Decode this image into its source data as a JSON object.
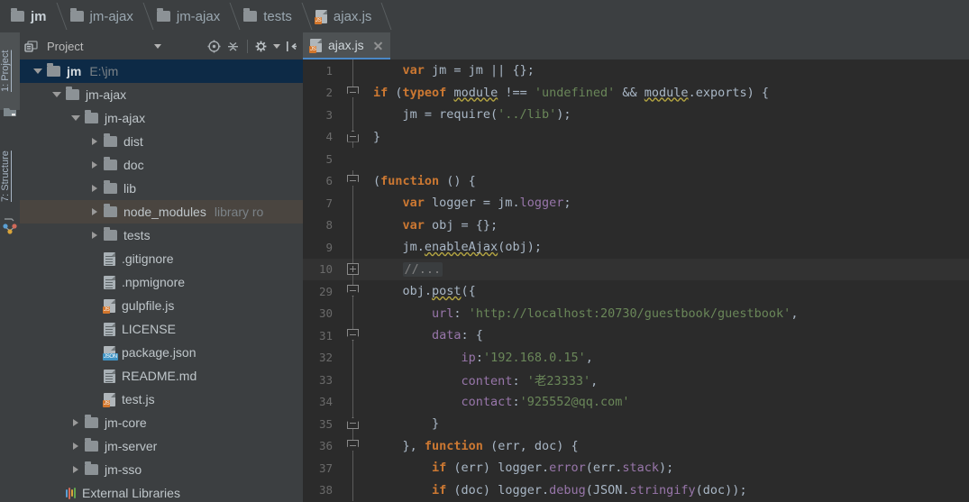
{
  "breadcrumb": [
    {
      "label": "jm",
      "icon": "folder-icon",
      "bold": true
    },
    {
      "label": "jm-ajax",
      "icon": "folder-icon",
      "bold": false
    },
    {
      "label": "jm-ajax",
      "icon": "folder-icon",
      "bold": false
    },
    {
      "label": "tests",
      "icon": "folder-icon",
      "bold": false
    },
    {
      "label": "ajax.js",
      "icon": "js-file-icon",
      "bold": false
    }
  ],
  "toolwindows": [
    {
      "label": "1: Project",
      "icon": "project-icon",
      "selected": true
    },
    {
      "label": "7: Structure",
      "icon": "structure-icon",
      "selected": false
    }
  ],
  "project_panel": {
    "title": "Project",
    "toolbar_icons": [
      "select-opened-file-icon",
      "collapse-all-icon",
      "settings-gear-icon",
      "hide-panel-icon"
    ],
    "tree": [
      {
        "label": "jm",
        "suffix": "E:\\jm",
        "depth": 0,
        "icon": "folder-icon",
        "twisty": "open",
        "state": "selected",
        "bold": true
      },
      {
        "label": "jm-ajax",
        "suffix": "",
        "depth": 1,
        "icon": "folder-icon",
        "twisty": "open",
        "state": "",
        "bold": false
      },
      {
        "label": "jm-ajax",
        "suffix": "",
        "depth": 2,
        "icon": "folder-icon",
        "twisty": "open",
        "state": "",
        "bold": false
      },
      {
        "label": "dist",
        "suffix": "",
        "depth": 3,
        "icon": "folder-icon",
        "twisty": "closed",
        "state": "",
        "bold": false
      },
      {
        "label": "doc",
        "suffix": "",
        "depth": 3,
        "icon": "folder-icon",
        "twisty": "closed",
        "state": "",
        "bold": false
      },
      {
        "label": "lib",
        "suffix": "",
        "depth": 3,
        "icon": "folder-icon",
        "twisty": "closed",
        "state": "",
        "bold": false
      },
      {
        "label": "node_modules",
        "suffix": "library ro",
        "depth": 3,
        "icon": "folder-icon",
        "twisty": "closed",
        "state": "hover",
        "bold": false
      },
      {
        "label": "tests",
        "suffix": "",
        "depth": 3,
        "icon": "folder-icon",
        "twisty": "closed",
        "state": "",
        "bold": false
      },
      {
        "label": ".gitignore",
        "suffix": "",
        "depth": 3,
        "icon": "text-file-icon",
        "twisty": "none",
        "state": "",
        "bold": false
      },
      {
        "label": ".npmignore",
        "suffix": "",
        "depth": 3,
        "icon": "text-file-icon",
        "twisty": "none",
        "state": "",
        "bold": false
      },
      {
        "label": "gulpfile.js",
        "suffix": "",
        "depth": 3,
        "icon": "js-file-icon",
        "twisty": "none",
        "state": "",
        "bold": false
      },
      {
        "label": "LICENSE",
        "suffix": "",
        "depth": 3,
        "icon": "text-file-icon",
        "twisty": "none",
        "state": "",
        "bold": false
      },
      {
        "label": "package.json",
        "suffix": "",
        "depth": 3,
        "icon": "json-file-icon",
        "twisty": "none",
        "state": "",
        "bold": false
      },
      {
        "label": "README.md",
        "suffix": "",
        "depth": 3,
        "icon": "text-file-icon",
        "twisty": "none",
        "state": "",
        "bold": false
      },
      {
        "label": "test.js",
        "suffix": "",
        "depth": 3,
        "icon": "js-file-icon",
        "twisty": "none",
        "state": "",
        "bold": false
      },
      {
        "label": "jm-core",
        "suffix": "",
        "depth": 2,
        "icon": "folder-icon",
        "twisty": "closed",
        "state": "",
        "bold": false
      },
      {
        "label": "jm-server",
        "suffix": "",
        "depth": 2,
        "icon": "folder-icon",
        "twisty": "closed",
        "state": "",
        "bold": false
      },
      {
        "label": "jm-sso",
        "suffix": "",
        "depth": 2,
        "icon": "folder-icon",
        "twisty": "closed",
        "state": "",
        "bold": false
      },
      {
        "label": "External Libraries",
        "suffix": "",
        "depth": 1,
        "icon": "external-libraries-icon",
        "twisty": "none",
        "state": "",
        "bold": false
      }
    ]
  },
  "editor": {
    "tabs": [
      {
        "label": "ajax.js",
        "icon": "js-file-icon",
        "active": true,
        "closable": true
      }
    ],
    "lines": [
      {
        "n": "1",
        "fold": "none",
        "bar": true,
        "highlight": false,
        "tokens": [
          {
            "t": "    ",
            "c": "pl"
          },
          {
            "t": "var",
            "c": "kw"
          },
          {
            "t": " jm = jm || {};",
            "c": "pl"
          }
        ]
      },
      {
        "n": "2",
        "fold": "top",
        "bar": false,
        "highlight": false,
        "tokens": [
          {
            "t": "",
            "c": "pl"
          },
          {
            "t": "if",
            "c": "kw"
          },
          {
            "t": " (",
            "c": "pl"
          },
          {
            "t": "typeof",
            "c": "kw"
          },
          {
            "t": " ",
            "c": "pl"
          },
          {
            "t": "module",
            "c": "warn"
          },
          {
            "t": " !== ",
            "c": "pl"
          },
          {
            "t": "'undefined'",
            "c": "str"
          },
          {
            "t": " && ",
            "c": "pl"
          },
          {
            "t": "module",
            "c": "warn"
          },
          {
            "t": ".exports) {",
            "c": "pl"
          }
        ]
      },
      {
        "n": "3",
        "fold": "none",
        "bar": true,
        "highlight": false,
        "tokens": [
          {
            "t": "    jm = require(",
            "c": "pl"
          },
          {
            "t": "'../lib'",
            "c": "str"
          },
          {
            "t": ");",
            "c": "pl"
          }
        ]
      },
      {
        "n": "4",
        "fold": "bottom",
        "bar": false,
        "highlight": false,
        "tokens": [
          {
            "t": "}",
            "c": "pl"
          }
        ]
      },
      {
        "n": "5",
        "fold": "none",
        "bar": false,
        "highlight": false,
        "tokens": []
      },
      {
        "n": "6",
        "fold": "top",
        "bar": false,
        "highlight": false,
        "tokens": [
          {
            "t": "(",
            "c": "pl"
          },
          {
            "t": "function",
            "c": "kw"
          },
          {
            "t": " () {",
            "c": "pl"
          }
        ]
      },
      {
        "n": "7",
        "fold": "none",
        "bar": true,
        "highlight": false,
        "tokens": [
          {
            "t": "    ",
            "c": "pl"
          },
          {
            "t": "var",
            "c": "kw"
          },
          {
            "t": " logger = jm.",
            "c": "pl"
          },
          {
            "t": "logger",
            "c": "prop"
          },
          {
            "t": ";",
            "c": "pl"
          }
        ]
      },
      {
        "n": "8",
        "fold": "none",
        "bar": true,
        "highlight": false,
        "tokens": [
          {
            "t": "    ",
            "c": "pl"
          },
          {
            "t": "var",
            "c": "kw"
          },
          {
            "t": " obj = {};",
            "c": "pl"
          }
        ]
      },
      {
        "n": "9",
        "fold": "none",
        "bar": true,
        "highlight": false,
        "tokens": [
          {
            "t": "    jm.",
            "c": "pl"
          },
          {
            "t": "enableAjax",
            "c": "warn"
          },
          {
            "t": "(obj);",
            "c": "pl"
          }
        ]
      },
      {
        "n": "10",
        "fold": "plus",
        "bar": true,
        "highlight": true,
        "tokens": [
          {
            "t": "    ",
            "c": "pl"
          },
          {
            "t": "//...",
            "c": "cmt fold-b"
          }
        ]
      },
      {
        "n": "29",
        "fold": "top",
        "bar": true,
        "highlight": false,
        "tokens": [
          {
            "t": "    obj.",
            "c": "pl"
          },
          {
            "t": "post",
            "c": "warn"
          },
          {
            "t": "({",
            "c": "pl"
          }
        ]
      },
      {
        "n": "30",
        "fold": "none",
        "bar": true,
        "highlight": false,
        "tokens": [
          {
            "t": "        ",
            "c": "pl"
          },
          {
            "t": "url",
            "c": "prop"
          },
          {
            "t": ": ",
            "c": "pl"
          },
          {
            "t": "'http://localhost:20730/guestbook/guestbook'",
            "c": "str"
          },
          {
            "t": ",",
            "c": "pl"
          }
        ]
      },
      {
        "n": "31",
        "fold": "top",
        "bar": true,
        "highlight": false,
        "tokens": [
          {
            "t": "        ",
            "c": "pl"
          },
          {
            "t": "data",
            "c": "prop"
          },
          {
            "t": ": {",
            "c": "pl"
          }
        ]
      },
      {
        "n": "32",
        "fold": "none",
        "bar": true,
        "highlight": false,
        "tokens": [
          {
            "t": "            ",
            "c": "pl"
          },
          {
            "t": "ip",
            "c": "prop"
          },
          {
            "t": ":",
            "c": "pl"
          },
          {
            "t": "'192.168.0.15'",
            "c": "str"
          },
          {
            "t": ",",
            "c": "pl"
          }
        ]
      },
      {
        "n": "33",
        "fold": "none",
        "bar": true,
        "highlight": false,
        "tokens": [
          {
            "t": "            ",
            "c": "pl"
          },
          {
            "t": "content",
            "c": "prop"
          },
          {
            "t": ": ",
            "c": "pl"
          },
          {
            "t": "'老23333'",
            "c": "str"
          },
          {
            "t": ",",
            "c": "pl"
          }
        ]
      },
      {
        "n": "34",
        "fold": "none",
        "bar": true,
        "highlight": false,
        "tokens": [
          {
            "t": "            ",
            "c": "pl"
          },
          {
            "t": "contact",
            "c": "prop"
          },
          {
            "t": ":",
            "c": "pl"
          },
          {
            "t": "'925552@qq.com'",
            "c": "str"
          }
        ]
      },
      {
        "n": "35",
        "fold": "bottom",
        "bar": true,
        "highlight": false,
        "tokens": [
          {
            "t": "        }",
            "c": "pl"
          }
        ]
      },
      {
        "n": "36",
        "fold": "top",
        "bar": true,
        "highlight": false,
        "tokens": [
          {
            "t": "    }, ",
            "c": "pl"
          },
          {
            "t": "function",
            "c": "kw"
          },
          {
            "t": " (err, doc) {",
            "c": "pl"
          }
        ]
      },
      {
        "n": "37",
        "fold": "none",
        "bar": true,
        "highlight": false,
        "tokens": [
          {
            "t": "        ",
            "c": "pl"
          },
          {
            "t": "if",
            "c": "kw"
          },
          {
            "t": " (err) logger.",
            "c": "pl"
          },
          {
            "t": "error",
            "c": "prop"
          },
          {
            "t": "(err.",
            "c": "pl"
          },
          {
            "t": "stack",
            "c": "prop"
          },
          {
            "t": ");",
            "c": "pl"
          }
        ]
      },
      {
        "n": "38",
        "fold": "none",
        "bar": true,
        "highlight": false,
        "tokens": [
          {
            "t": "        ",
            "c": "pl"
          },
          {
            "t": "if",
            "c": "kw"
          },
          {
            "t": " (doc) logger.",
            "c": "pl"
          },
          {
            "t": "debug",
            "c": "prop"
          },
          {
            "t": "(JSON.",
            "c": "pl"
          },
          {
            "t": "stringify",
            "c": "prop"
          },
          {
            "t": "(doc));",
            "c": "pl"
          }
        ]
      }
    ]
  },
  "colors": {
    "panel_bg": "#3c3f41",
    "editor_bg": "#2b2b2b",
    "selection": "#0d2a46",
    "hover": "#4a4540",
    "accent": "#4a88c7",
    "keyword": "#cc7832",
    "string": "#6a8759",
    "property": "#9876aa",
    "comment": "#808080",
    "js_badge": "#d2762c",
    "json_badge": "#3f93c4"
  }
}
